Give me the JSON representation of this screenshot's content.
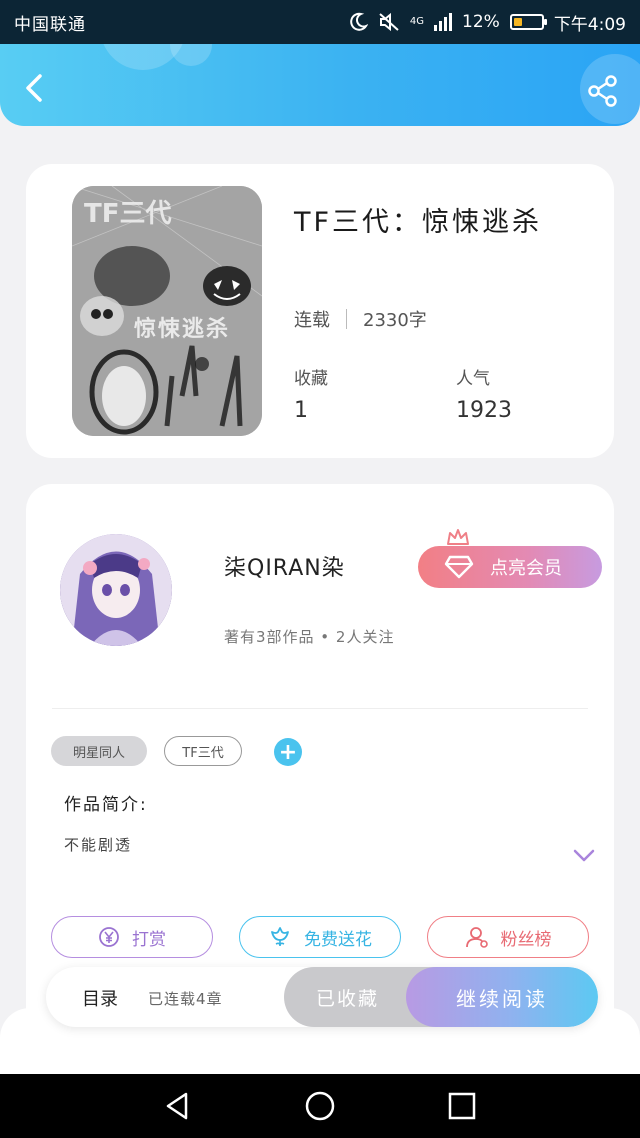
{
  "status_bar": {
    "carrier": "中国联通",
    "network": "4G",
    "battery_percent": "12%",
    "time": "下午4:09",
    "icons": [
      "moon-icon",
      "mute-icon",
      "signal-icon",
      "battery-icon"
    ]
  },
  "header": {
    "icons": [
      "back-arrow-icon",
      "share-icon"
    ],
    "accent": "#3bb2f2"
  },
  "book": {
    "title": "TF三代：惊悚逃杀",
    "cover_text": "TF三代",
    "cover_subtitle": "惊悚逃杀",
    "status": "连载",
    "word_count": "2330字",
    "favorites_label": "收藏",
    "favorites_value": "1",
    "popularity_label": "人气",
    "popularity_value": "1923"
  },
  "author": {
    "name": "柒QIRAN染",
    "stats": "著有3部作品 • 2人关注",
    "vip_label": "点亮会员",
    "tags": [
      "明星同人",
      "TF三代"
    ],
    "intro_heading": "作品简介:",
    "intro_text": "不能剧透",
    "actions": {
      "reward": "打赏",
      "flower": "免费送花",
      "fans": "粉丝榜"
    }
  },
  "read_bar": {
    "toc_label": "目录",
    "toc_info": "已连载4章",
    "collected_label": "已收藏",
    "continue_label": "继续阅读"
  },
  "colors": {
    "vip_start": "#f27f85",
    "vip_end": "#c79be0",
    "reward": "#9a73d1",
    "flower": "#37b4e3",
    "fans": "#e86a73"
  }
}
